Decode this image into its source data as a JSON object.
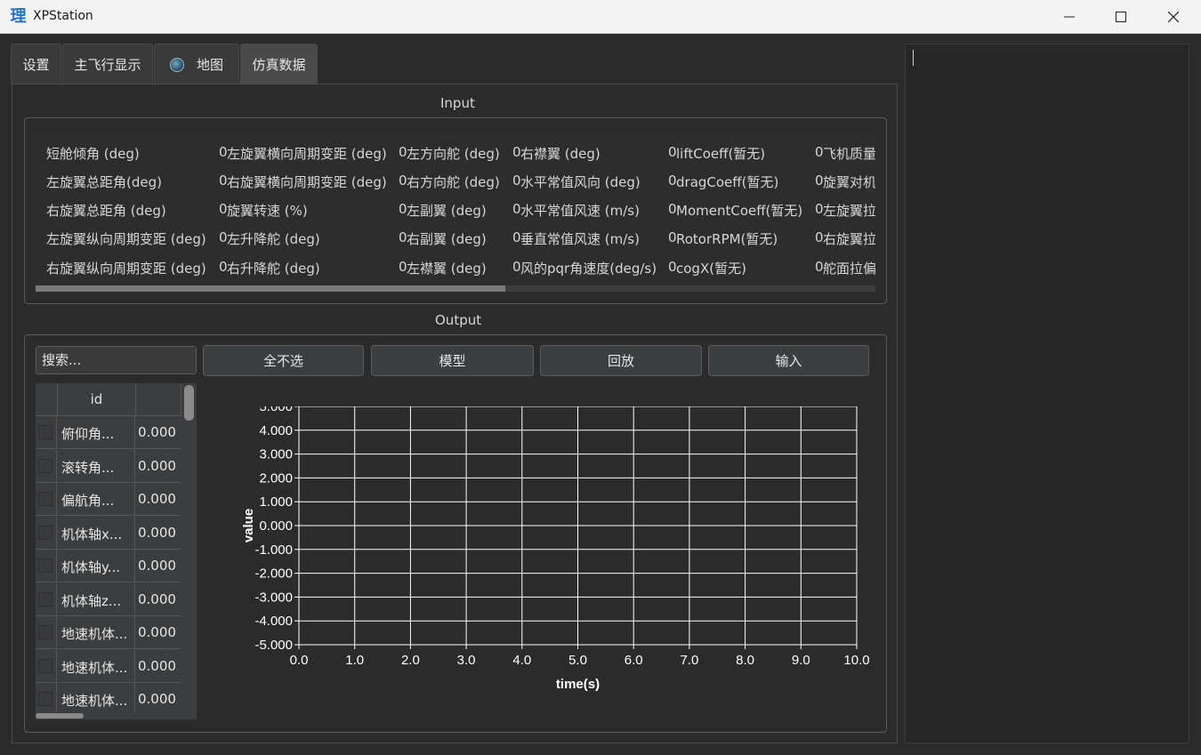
{
  "window": {
    "title": "XPStation",
    "app_icon": "理"
  },
  "tabs": [
    {
      "label": "设置"
    },
    {
      "label": "主飞行显示"
    },
    {
      "label": "地图"
    },
    {
      "label": "仿真数据"
    }
  ],
  "input": {
    "title": "Input",
    "columns": [
      [
        {
          "label": "短舱倾角 (deg)",
          "value": "0"
        },
        {
          "label": "左旋翼总距角(deg)",
          "value": "0"
        },
        {
          "label": "右旋翼总距角 (deg)",
          "value": "0"
        },
        {
          "label": "左旋翼纵向周期变距 (deg)",
          "value": "0"
        },
        {
          "label": "右旋翼纵向周期变距 (deg)",
          "value": "0"
        }
      ],
      [
        {
          "label": "左旋翼横向周期变距 (deg)",
          "value": "0"
        },
        {
          "label": "右旋翼横向周期变距 (deg)",
          "value": "0"
        },
        {
          "label": "旋翼转速 (%)",
          "value": "0"
        },
        {
          "label": "左升降舵 (deg)",
          "value": "0"
        },
        {
          "label": "右升降舵 (deg)",
          "value": "0"
        }
      ],
      [
        {
          "label": "左方向舵 (deg)",
          "value": "0"
        },
        {
          "label": "右方向舵 (deg)",
          "value": "0"
        },
        {
          "label": "左副翼 (deg)",
          "value": "0"
        },
        {
          "label": "右副翼 (deg)",
          "value": "0"
        },
        {
          "label": "左襟翼 (deg)",
          "value": "0"
        }
      ],
      [
        {
          "label": "右襟翼 (deg)",
          "value": "0"
        },
        {
          "label": "水平常值风向 (deg)",
          "value": "0"
        },
        {
          "label": "水平常值风速 (m/s)",
          "value": "0"
        },
        {
          "label": "垂直常值风速 (m/s)",
          "value": "0"
        },
        {
          "label": "风的pqr角速度(deg/s)",
          "value": "0"
        }
      ],
      [
        {
          "label": "liftCoeff(暂无)",
          "value": "0"
        },
        {
          "label": "dragCoeff(暂无)",
          "value": "0"
        },
        {
          "label": "MomentCoeff(暂无)",
          "value": "0"
        },
        {
          "label": "RotorRPM(暂无)",
          "value": "0"
        },
        {
          "label": "cogX(暂无)",
          "value": "0"
        }
      ],
      [
        {
          "label": "飞机质量",
          "value": ""
        },
        {
          "label": "旋翼对机",
          "value": ""
        },
        {
          "label": "左旋翼拉",
          "value": ""
        },
        {
          "label": "右旋翼拉",
          "value": ""
        },
        {
          "label": "舵面拉偏",
          "value": ""
        }
      ]
    ]
  },
  "output": {
    "title": "Output",
    "search_placeholder": "搜索...",
    "buttons": {
      "deselect_all": "全不选",
      "model": "模型",
      "playback": "回放",
      "input": "输入"
    },
    "table": {
      "headers": [
        "",
        "id",
        ""
      ],
      "rows": [
        {
          "name": "俯仰角...",
          "value": "0.000"
        },
        {
          "name": "滚转角...",
          "value": "0.000"
        },
        {
          "name": "偏航角...",
          "value": "0.000"
        },
        {
          "name": "机体轴x...",
          "value": "0.000"
        },
        {
          "name": "机体轴y...",
          "value": "0.000"
        },
        {
          "name": "机体轴z...",
          "value": "0.000"
        },
        {
          "name": "地速机体...",
          "value": "0.000"
        },
        {
          "name": "地速机体...",
          "value": "0.000"
        },
        {
          "name": "地速机体...",
          "value": "0.000"
        }
      ]
    }
  },
  "chart_data": {
    "type": "line",
    "title": "",
    "xlabel": "time(s)",
    "ylabel": "value",
    "xlim": [
      0.0,
      10.0
    ],
    "ylim": [
      -5.0,
      5.0
    ],
    "xticks": [
      "0.0",
      "1.0",
      "2.0",
      "3.0",
      "4.0",
      "5.0",
      "6.0",
      "7.0",
      "8.0",
      "9.0",
      "10.0"
    ],
    "yticks": [
      "5.000",
      "4.000",
      "3.000",
      "2.000",
      "1.000",
      "0.000",
      "-1.000",
      "-2.000",
      "-3.000",
      "-4.000",
      "-5.000"
    ],
    "grid": true,
    "series": []
  },
  "colors": {
    "background": "#2b2b2b",
    "titlebar": "#f3f3f3",
    "grid": "#ffffff"
  }
}
